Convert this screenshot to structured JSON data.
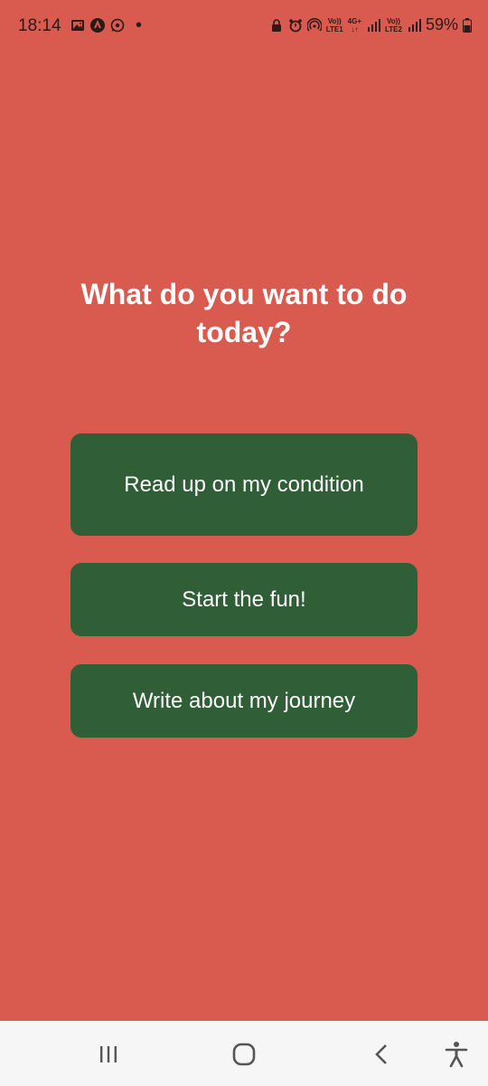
{
  "status_bar": {
    "time": "18:14",
    "battery": "59%",
    "sim1_top": "Vo))",
    "sim1_bottom": "LTE1",
    "net_top": "4G+",
    "net_bottom": "↓↑",
    "sim2_top": "Vo))",
    "sim2_bottom": "LTE2",
    "left_icons": [
      "gallery-icon",
      "app-a-icon",
      "whatsapp-icon",
      "notification-dot"
    ],
    "right_icons": [
      "lock-icon",
      "alarm-icon",
      "hotspot-icon",
      "signal-icon",
      "battery-icon"
    ]
  },
  "main": {
    "heading": "What do you want to do today?",
    "options": [
      {
        "label": "Read up on my condition"
      },
      {
        "label": "Start the fun!"
      },
      {
        "label": "Write about my journey"
      }
    ]
  },
  "nav_bar": {
    "icons": [
      "recent-apps-icon",
      "home-icon",
      "back-icon",
      "accessibility-icon"
    ]
  },
  "colors": {
    "background": "#d95a4f",
    "button": "#2f5e37",
    "text": "#ffffff",
    "nav_background": "#f6f6f6"
  }
}
